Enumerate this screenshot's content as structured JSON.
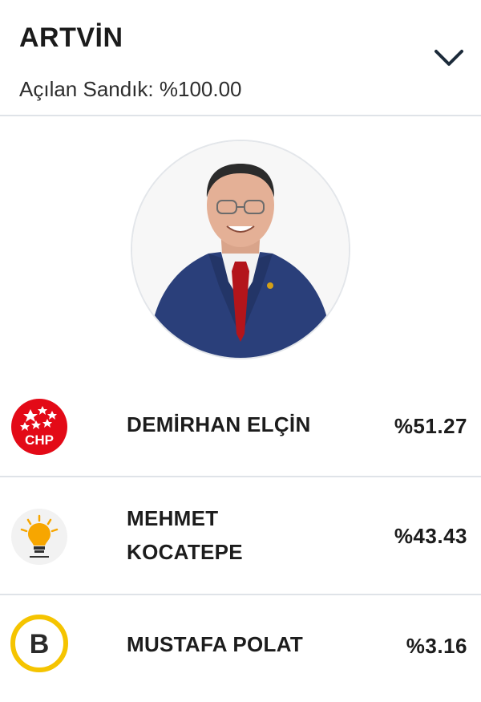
{
  "header": {
    "title": "ARTVİN",
    "subtitle": "Açılan Sandık: %100.00",
    "toggle_icon": "chevron-down-icon"
  },
  "candidates": [
    {
      "name": "DEMİRHAN ELÇİN",
      "percent": "%51.27",
      "party_logo": "chp-logo",
      "party_text": "CHP",
      "color": "#e30a17"
    },
    {
      "name": "MEHMET KOCATEPE",
      "percent": "%43.43",
      "party_logo": "ak-parti-logo",
      "color": "#f7a600"
    },
    {
      "name": "MUSTAFA POLAT",
      "percent": "%3.16",
      "party_logo": "b-party-logo",
      "party_text": "B",
      "color": "#f5c400"
    }
  ]
}
